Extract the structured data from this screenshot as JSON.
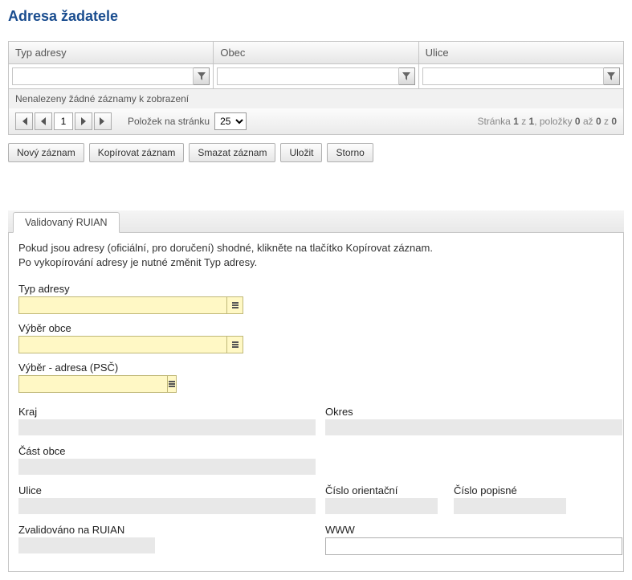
{
  "title": "Adresa žadatele",
  "grid": {
    "headers": [
      "Typ adresy",
      "Obec",
      "Ulice"
    ],
    "empty_text": "Nenalezeny žádné záznamy k zobrazení",
    "pager": {
      "page_value": "1",
      "per_page_label": "Položek na stránku",
      "per_page_value": "25"
    },
    "status": {
      "prefix": "Stránka ",
      "page": "1",
      "of_word": " z ",
      "total_pages": "1",
      "items_word": ", položky ",
      "from": "0",
      "to_word": " až ",
      "to": "0",
      "of2_word": " z ",
      "total": "0"
    }
  },
  "actions": {
    "new": "Nový záznam",
    "copy": "Kopírovat záznam",
    "delete": "Smazat záznam",
    "save": "Uložit",
    "cancel": "Storno"
  },
  "tab": {
    "label": "Validovaný RUIAN"
  },
  "info": {
    "line1": "Pokud jsou adresy (oficiální, pro doručení) shodné, klikněte na tlačítko Kopírovat záznam.",
    "line2": "Po vykopírování adresy je nutné změnit Typ adresy."
  },
  "form": {
    "typ_adresy": {
      "label": "Typ adresy",
      "value": ""
    },
    "vyber_obce": {
      "label": "Výběr obce",
      "value": ""
    },
    "vyber_adresa_psc": {
      "label": "Výběr - adresa (PSČ)",
      "value": ""
    },
    "kraj": {
      "label": "Kraj",
      "value": ""
    },
    "okres": {
      "label": "Okres",
      "value": ""
    },
    "cast_obce": {
      "label": "Část obce",
      "value": ""
    },
    "ulice": {
      "label": "Ulice",
      "value": ""
    },
    "cislo_orientacni": {
      "label": "Číslo orientační",
      "value": ""
    },
    "cislo_popisne": {
      "label": "Číslo popisné",
      "value": ""
    },
    "zvalidovano": {
      "label": "Zvalidováno na RUIAN",
      "value": ""
    },
    "www": {
      "label": "WWW",
      "value": ""
    }
  }
}
